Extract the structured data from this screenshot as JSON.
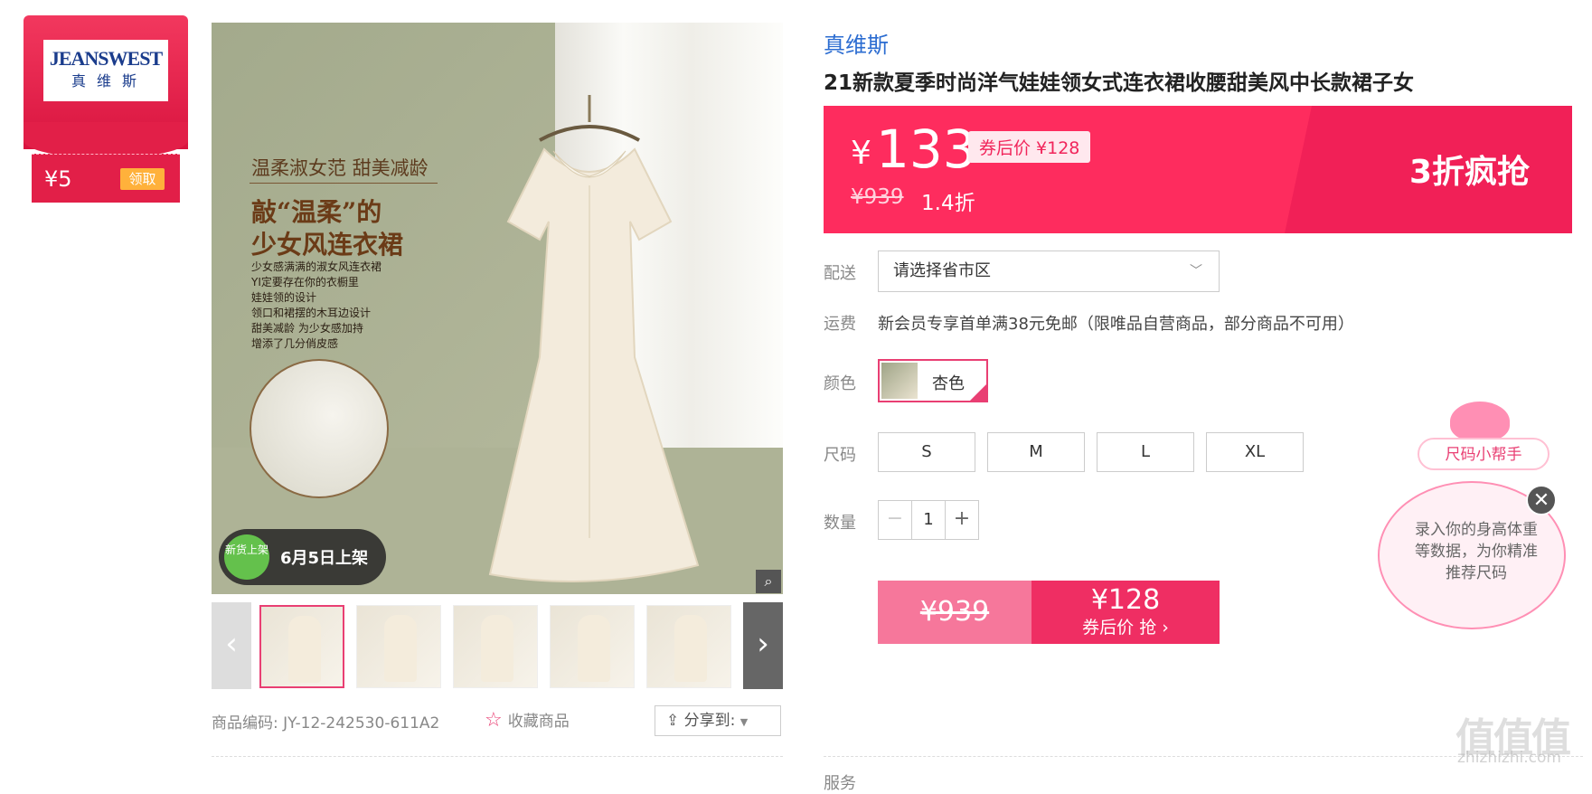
{
  "coupon": {
    "logo_text": "JEANSWEST",
    "logo_sub": "真 维 斯",
    "amount": "¥5",
    "claim_label": "领取"
  },
  "main_image": {
    "headline_small": "温柔淑女范  甜美减龄",
    "headline_line1": "敲“温柔”的",
    "headline_line2": "少女风连衣裙",
    "bullets": [
      "少女感满满的淑女风连衣裙",
      "YI定要存在你的衣橱里",
      "娃娃领的设计",
      "领口和裙摆的木耳边设计",
      "甜美减龄 为少女感加持",
      "增添了几分俏皮感"
    ],
    "new_badge": "新货上架",
    "release_text": "6月5日上架"
  },
  "product": {
    "code_label": "商品编码:",
    "code": "JY-12-242530-611A2",
    "favorite_label": "收藏商品",
    "share_label": "分享到:",
    "brand": "真维斯",
    "title": "21新款夏季时尚洋气娃娃领女式连衣裙收腰甜美风中长款裙子女"
  },
  "price": {
    "currency": "¥",
    "current": "133",
    "after_coupon": "券后价 ¥128",
    "original": "¥939",
    "discount": "1.4折",
    "promo": "3折疯抢"
  },
  "labels": {
    "delivery": "配送",
    "shipping": "运费",
    "color": "颜色",
    "size": "尺码",
    "quantity": "数量",
    "service": "服务"
  },
  "delivery": {
    "placeholder": "请选择省市区"
  },
  "shipping": {
    "text": "新会员专享首单满38元免邮（限唯品自营商品，部分商品不可用）"
  },
  "color": {
    "selected": "杏色"
  },
  "sizes": [
    "S",
    "M",
    "L",
    "XL"
  ],
  "quantity": {
    "minus": "−",
    "value": "1",
    "plus": "+"
  },
  "buy": {
    "original": "¥939",
    "price": "¥128",
    "cta": "券后价 抢 ›"
  },
  "size_helper": {
    "tag": "尺码小帮手",
    "text": "录入你的身高体重等数据，为你精准推荐尺码",
    "close": "✕"
  },
  "watermark": {
    "text": "值值值",
    "site": "zhizhizhi.com"
  },
  "colors": {
    "accent": "#fe2c5e",
    "brand_link": "#2b6cd1",
    "selected_border": "#e93f73"
  }
}
